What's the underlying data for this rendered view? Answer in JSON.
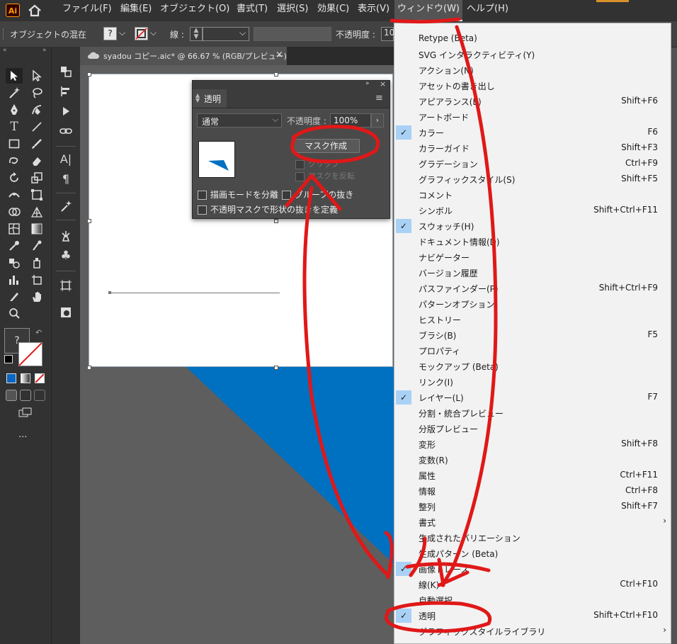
{
  "app": {
    "logo": "Ai"
  },
  "menubar": {
    "items": [
      {
        "label": "ファイル(F)"
      },
      {
        "label": "編集(E)"
      },
      {
        "label": "オブジェクト(O)"
      },
      {
        "label": "書式(T)"
      },
      {
        "label": "選択(S)"
      },
      {
        "label": "効果(C)"
      },
      {
        "label": "表示(V)"
      },
      {
        "label": "ウィンドウ(W)"
      },
      {
        "label": "ヘルプ(H)"
      }
    ]
  },
  "controlbar": {
    "mode_label": "オブジェクトの混在",
    "fill_value": "?",
    "stroke_label": "線 :",
    "opacity_label": "不透明度 :",
    "opacity_value": "10"
  },
  "document": {
    "tab_title": "syadou コピー.aic* @ 66.67 % (RGB/プレビュー)",
    "close": "×"
  },
  "toolbar": {
    "color_unknown": "?",
    "more": "..."
  },
  "transparency_panel": {
    "title": "透明",
    "blend_mode": "通常",
    "opacity_label": "不透明度 :",
    "opacity_value": "100%",
    "make_mask_button": "マスク作成",
    "clip_label": "クリップ",
    "invert_mask_label": "マスクを反転",
    "isolate_blending": "描画モードを分離",
    "knockout_group": "グループの抜き",
    "opacity_mask_define": "不透明マスクで形状の抜きを定義"
  },
  "window_menu": {
    "items": [
      {
        "label": "Retype (Beta)",
        "shortcut": "",
        "checked": false
      },
      {
        "label": "SVG インタラクティビティ(Y)",
        "shortcut": "",
        "checked": false
      },
      {
        "label": "アクション(N)",
        "shortcut": "",
        "checked": false
      },
      {
        "label": "アセットの書き出し",
        "shortcut": "",
        "checked": false
      },
      {
        "label": "アピアランス(E)",
        "shortcut": "Shift+F6",
        "checked": false
      },
      {
        "label": "アートボード",
        "shortcut": "",
        "checked": false
      },
      {
        "label": "カラー",
        "shortcut": "F6",
        "checked": true
      },
      {
        "label": "カラーガイド",
        "shortcut": "Shift+F3",
        "checked": false
      },
      {
        "label": "グラデーション",
        "shortcut": "Ctrl+F9",
        "checked": false
      },
      {
        "label": "グラフィックスタイル(S)",
        "shortcut": "Shift+F5",
        "checked": false
      },
      {
        "label": "コメント",
        "shortcut": "",
        "checked": false
      },
      {
        "label": "シンボル",
        "shortcut": "Shift+Ctrl+F11",
        "checked": false
      },
      {
        "label": "スウォッチ(H)",
        "shortcut": "",
        "checked": true
      },
      {
        "label": "ドキュメント情報(D)",
        "shortcut": "",
        "checked": false
      },
      {
        "label": "ナビゲーター",
        "shortcut": "",
        "checked": false
      },
      {
        "label": "バージョン履歴",
        "shortcut": "",
        "checked": false
      },
      {
        "label": "パスファインダー(P)",
        "shortcut": "Shift+Ctrl+F9",
        "checked": false
      },
      {
        "label": "パターンオプション",
        "shortcut": "",
        "checked": false
      },
      {
        "label": "ヒストリー",
        "shortcut": "",
        "checked": false
      },
      {
        "label": "ブラシ(B)",
        "shortcut": "F5",
        "checked": false
      },
      {
        "label": "プロパティ",
        "shortcut": "",
        "checked": false
      },
      {
        "label": "モックアップ (Beta)",
        "shortcut": "",
        "checked": false
      },
      {
        "label": "リンク(I)",
        "shortcut": "",
        "checked": false
      },
      {
        "label": "レイヤー(L)",
        "shortcut": "F7",
        "checked": true
      },
      {
        "label": "分割・統合プレビュー",
        "shortcut": "",
        "checked": false
      },
      {
        "label": "分版プレビュー",
        "shortcut": "",
        "checked": false
      },
      {
        "label": "変形",
        "shortcut": "Shift+F8",
        "checked": false
      },
      {
        "label": "変数(R)",
        "shortcut": "",
        "checked": false
      },
      {
        "label": "属性",
        "shortcut": "Ctrl+F11",
        "checked": false
      },
      {
        "label": "情報",
        "shortcut": "Ctrl+F8",
        "checked": false
      },
      {
        "label": "整列",
        "shortcut": "Shift+F7",
        "checked": false
      },
      {
        "label": "書式",
        "shortcut": "",
        "checked": false,
        "submenu": true
      },
      {
        "label": "生成されたバリエーション",
        "shortcut": "",
        "checked": false
      },
      {
        "label": "生成パターン (Beta)",
        "shortcut": "",
        "checked": false
      },
      {
        "label": "画像トレース",
        "shortcut": "",
        "checked": true
      },
      {
        "label": "線(K)",
        "shortcut": "Ctrl+F10",
        "checked": false
      },
      {
        "label": "自動選択",
        "shortcut": "",
        "checked": false
      },
      {
        "label": "透明",
        "shortcut": "Shift+Ctrl+F10",
        "checked": true
      },
      {
        "label": "グラフィックスタイルライブラリ",
        "shortcut": "",
        "checked": false,
        "submenu": true
      }
    ]
  },
  "colors": {
    "accent_blue": "#0070c0",
    "annotation_red": "#e01818",
    "check_bg": "#a9d1f5"
  }
}
